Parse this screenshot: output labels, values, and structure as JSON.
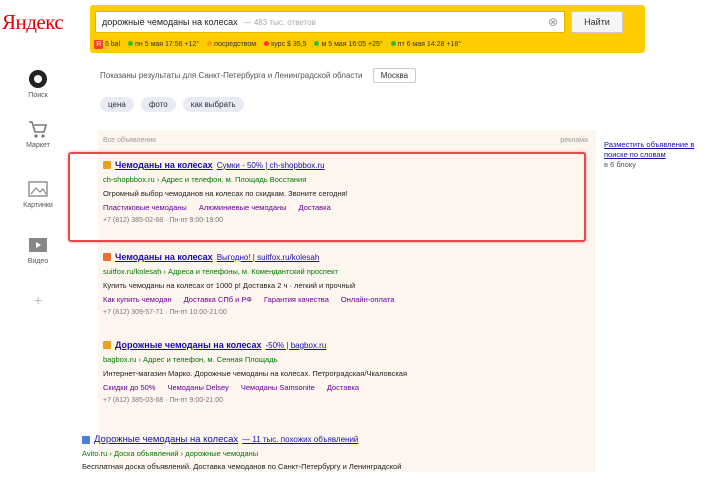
{
  "logo": "Яндекс",
  "search": {
    "query": "дорожные чемоданы на колесах",
    "hint": "— 483 тыс. ответов",
    "button": "Найти"
  },
  "region_bar": [
    {
      "text": "6 bal",
      "dot": "none"
    },
    {
      "text": "пн 5 мая 17:56 +12°",
      "dot": "g"
    },
    {
      "text": "посредством",
      "dot": "o"
    },
    {
      "text": "курс $ 35,5",
      "dot": "r"
    },
    {
      "text": "м 5 мая 16:05 +25°",
      "dot": "g"
    },
    {
      "text": "пт 6 мая 14:28 +18°",
      "dot": "g"
    }
  ],
  "nav": [
    {
      "label": "Поиск",
      "icon": "search-circle-icon"
    },
    {
      "label": "Маркет",
      "icon": "cart-icon"
    },
    {
      "label": "Картинки",
      "icon": "image-icon"
    },
    {
      "label": "Видео",
      "icon": "video-icon"
    }
  ],
  "region_note": {
    "text": "Показаны результаты для Санкт-Петербурга и Ленинградской области",
    "button": "Москва"
  },
  "chips": [
    "цена",
    "фото",
    "как выбрать"
  ],
  "ads": {
    "label": "Все объявления",
    "more": "реклама"
  },
  "results": [
    {
      "title": "Чемоданы на колесах",
      "url_title": "Сумки - 50% | ch-shopbbox.ru",
      "favicon": "#e8a020",
      "url": "ch-shopbbox.ru › Адрес и телефон, м. Площадь Восстания",
      "desc": "Огромный выбор чемоданов на колесах по скидкам. Звоните сегодня!",
      "links": [
        "Пластиковые чемоданы",
        "Алюминиевые чемоданы",
        "Доставка"
      ],
      "contact": "+7 (812) 385-02-68 · Пн-пт 9:00-19:00"
    },
    {
      "title": "Чемоданы на колесах",
      "url_title": "Выгодно! | suitfox.ru/kolesah",
      "favicon": "#f07030",
      "url": "suitfox.ru/kolesah › Адреса и телефоны, м. Комендантский проспект",
      "desc": "Купить чемоданы на колесах от 1000 р! Доставка 2 ч · легкий и прочный",
      "links": [
        "Как купить чемодан",
        "Доставка СПб и РФ",
        "Гарантия качества",
        "Онлайн-оплата"
      ],
      "contact": "+7 (812) 309-57-71 · Пн-пт 10:00-21:00"
    },
    {
      "title": "Дорожные чемоданы на колесах",
      "url_title": "-50% | bagbox.ru",
      "favicon": "#f0a020",
      "url": "bagbox.ru › Адрес и телефон, м. Сенная Площадь",
      "desc": "Интернет-магазин Марко. Дорожные чемоданы на колесах. Петроградская/Чкаловская",
      "links": [
        "Скидки до 50%",
        "Чемоданы Delsey",
        "Чемоданы Samsonite",
        "Доставка"
      ],
      "contact": "+7 (812) 385-03-68 · Пн-пт 9:00-21:00"
    }
  ],
  "organic": {
    "title": "Дорожные чемоданы на колесах",
    "url_title": "— 11 тыс. похожих объявлений",
    "url": "Avito.ru › Доска объявлений › дорожные чемоданы",
    "desc": "Бесплатная доска объявлений. Доставка чемоданов по Санкт-Петербургу и Ленинградской"
  },
  "right": {
    "link": "Разместить объявление в поиске по словам",
    "sub": "в 6 блоку"
  },
  "colors": {
    "accent": "#ffcc00",
    "link": "#1a0dab",
    "url": "#007700",
    "highlight": "#e24b4b"
  }
}
